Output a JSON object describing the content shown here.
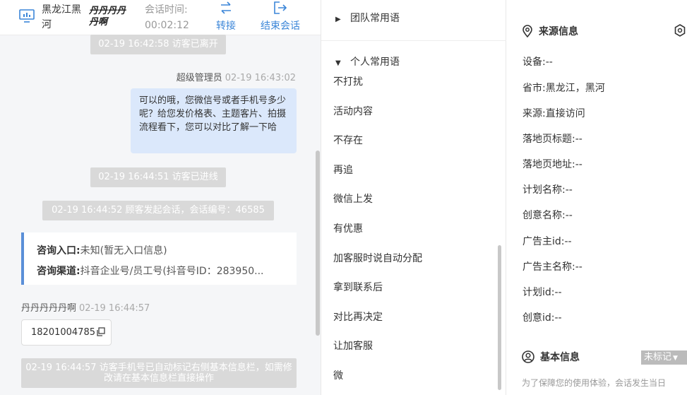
{
  "header": {
    "location": "黑龙江黑河",
    "visitor_name": "丹丹丹丹丹啊",
    "duration_label": "会话时间:",
    "duration_value": "00:02:12",
    "transfer_label": "转接",
    "end_label": "结束会话"
  },
  "chat": {
    "system_left": "02-19 16:42:58 访客已离开",
    "agent_name": "超级管理员",
    "agent_time": "02-19 16:43:02",
    "agent_message": "可以的哦，您微信号或者手机号多少呢？给您发价格表、主题客片、拍摄流程看下，您可以对比了解一下哈",
    "system_enter": "02-19 16:44:51 访客已进线",
    "system_start": "02-19 16:44:52 顾客发起会话，会话编号：46585",
    "consult_entry_label": "咨询入口:",
    "consult_entry_value": "未知(暂无入口信息)",
    "consult_channel_label": "咨询渠道:",
    "consult_channel_value": "抖音企业号/员工号(抖音号ID：283950...",
    "visitor_name": "丹丹丹丹丹啊",
    "visitor_time": "02-19 16:44:57",
    "phone": "18201004785",
    "system_auto": "02-19 16:44:57 访客手机号已自动标记右侧基本信息栏，如需修改请在基本信息栏直接操作"
  },
  "phrases": {
    "team_group": "团队常用语",
    "personal_group": "个人常用语",
    "items": [
      "不打扰",
      "活动内容",
      "不存在",
      "再追",
      "微信上发",
      "有优惠",
      "加客服时说自动分配",
      "拿到联系后",
      "对比再决定",
      "让加客服",
      "微"
    ]
  },
  "info": {
    "source_title": "来源信息",
    "rows": [
      {
        "label": "设备:",
        "value": "--"
      },
      {
        "label": "省市:",
        "value": "黑龙江，黑河"
      },
      {
        "label": "来源:",
        "value": "直接访问"
      },
      {
        "label": "落地页标题:",
        "value": "--"
      },
      {
        "label": "落地页地址:",
        "value": "--"
      },
      {
        "label": "计划名称:",
        "value": "--"
      },
      {
        "label": "创意名称:",
        "value": "--"
      },
      {
        "label": "广告主id:",
        "value": "--"
      },
      {
        "label": "广告主名称:",
        "value": "--"
      },
      {
        "label": "计划id:",
        "value": "--"
      },
      {
        "label": "创意id:",
        "value": "--"
      }
    ],
    "basic_title": "基本信息",
    "mark_label": "未标记",
    "basic_note": "为了保障您的使用体验，会话发生当日"
  },
  "colors": {
    "accent": "#3b86d8",
    "agent_bubble": "#dbe8fb",
    "system_pill": "#d9d9d9",
    "consult_border": "#5a8fd8"
  },
  "icons": [
    "monitor-icon",
    "transfer-icon",
    "exit-icon",
    "copy-icon",
    "caret-right-icon",
    "caret-down-icon",
    "location-pin-icon",
    "settings-icon",
    "user-icon",
    "dropdown-arrow-icon"
  ]
}
